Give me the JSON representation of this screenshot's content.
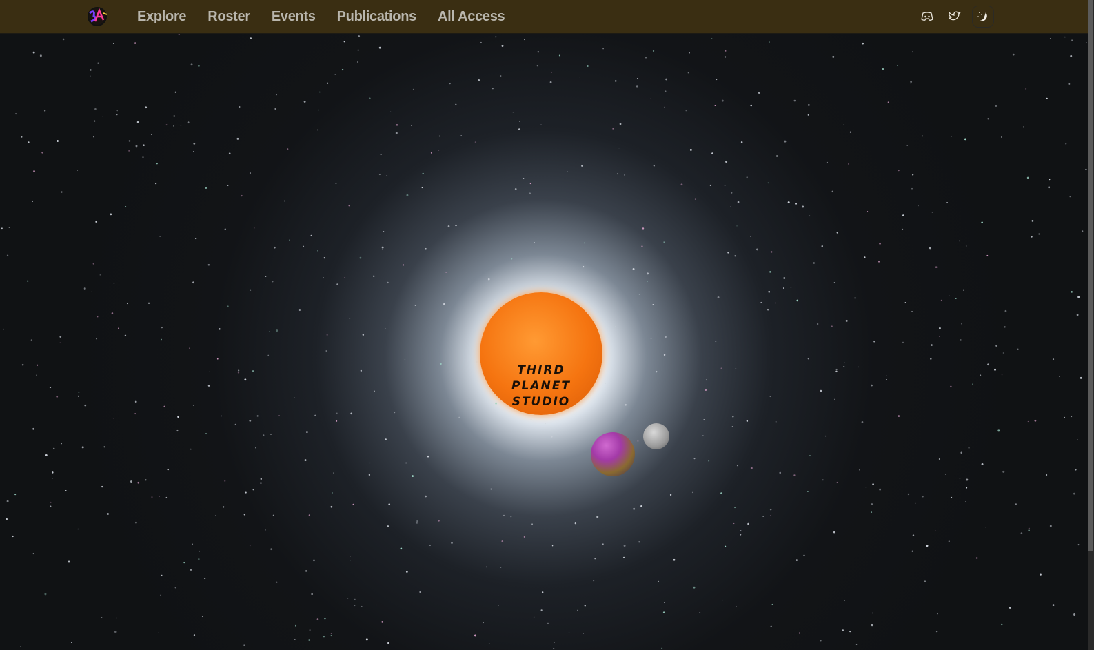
{
  "nav": {
    "logo_text": "3PS",
    "links": [
      {
        "label": "Explore"
      },
      {
        "label": "Roster"
      },
      {
        "label": "Events"
      },
      {
        "label": "Publications"
      },
      {
        "label": "All Access"
      }
    ],
    "icons": [
      "discord-icon",
      "twitter-icon",
      "moon-stars-icon"
    ]
  },
  "hero": {
    "sun_text": [
      "THIRD",
      "PLANET",
      "STUDIO"
    ]
  },
  "colors": {
    "nav_bg": "#3a2e12",
    "nav_text": "#b9b6ad",
    "sun": "#f57410"
  }
}
